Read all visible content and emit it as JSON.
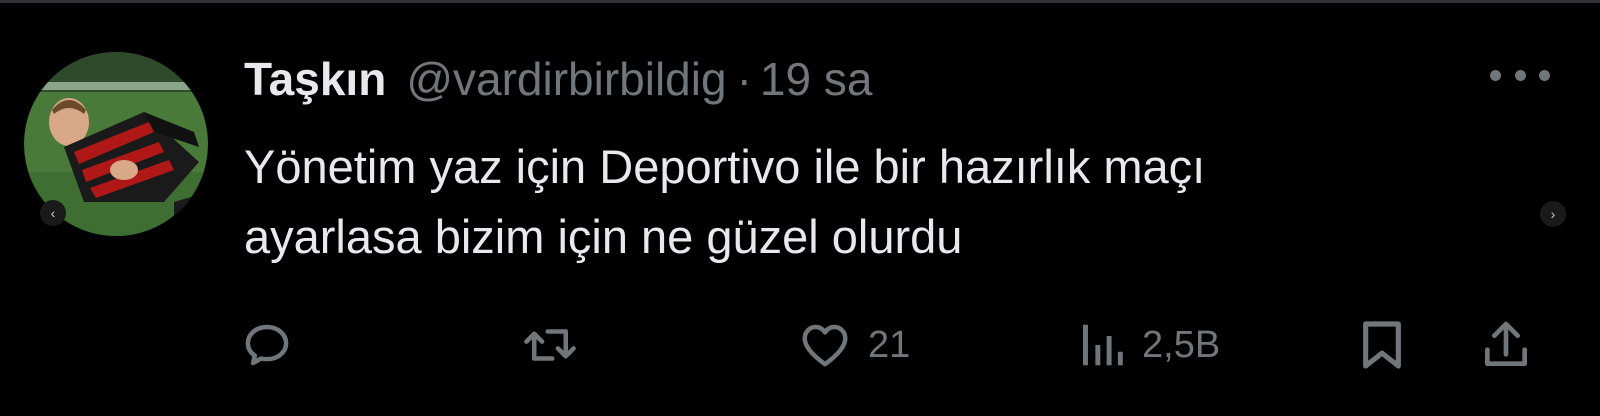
{
  "tweet": {
    "author_name": "Taşkın",
    "handle": "@vardirbirbildig",
    "separator": "·",
    "time": "19 sa",
    "text_lines": [
      "Yönetim yaz için Deportivo ile bir hazırlık maçı",
      "ayarlasa bizim için ne güzel olurdu"
    ],
    "avatar_icon": "profile-photo-football-player"
  },
  "nav": {
    "left_arrow": "‹",
    "right_arrow": "›"
  },
  "actions": {
    "reply": {
      "icon": "reply-icon"
    },
    "retweet": {
      "icon": "retweet-icon"
    },
    "like": {
      "icon": "heart-icon",
      "count": "21"
    },
    "views": {
      "icon": "views-icon",
      "count": "2,5B"
    },
    "bookmark": {
      "icon": "bookmark-icon"
    },
    "share": {
      "icon": "share-icon"
    }
  },
  "colors": {
    "background": "#000000",
    "text": "#e7e9ea",
    "muted": "#71767b"
  }
}
